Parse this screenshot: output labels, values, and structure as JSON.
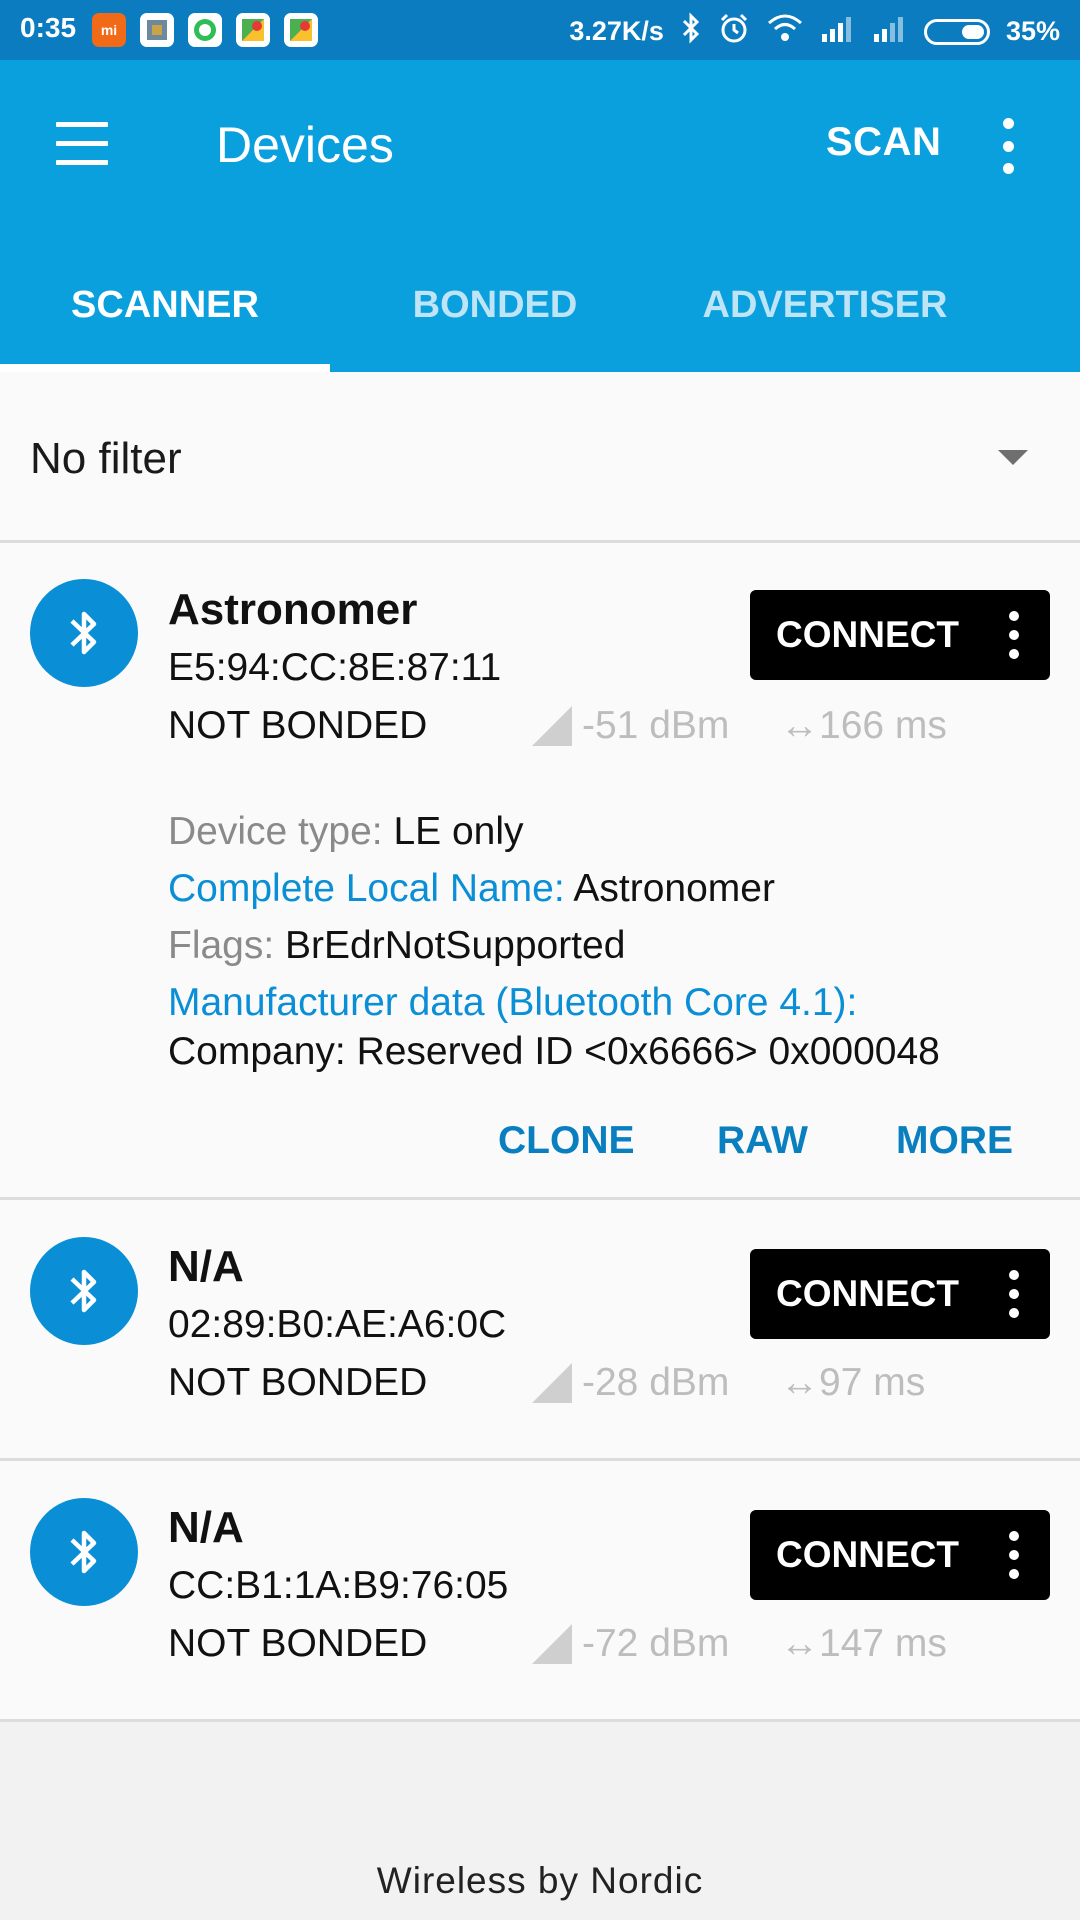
{
  "status_bar": {
    "time": "0:35",
    "notification_icons": [
      "mi-icon",
      "photo-app-icon",
      "whatsapp-icon",
      "maps-icon",
      "maps-icon"
    ],
    "net_speed": "3.27K/s",
    "battery": "35%"
  },
  "app_bar": {
    "title": "Devices",
    "scan_label": "SCAN",
    "tabs": [
      {
        "label": "SCANNER",
        "active": true
      },
      {
        "label": "BONDED",
        "active": false
      },
      {
        "label": "ADVERTISER",
        "active": false
      }
    ]
  },
  "filter": {
    "selected": "No filter"
  },
  "devices": [
    {
      "name": "Astronomer",
      "address": "E5:94:CC:8E:87:11",
      "bond": "NOT BONDED",
      "rssi": "-51 dBm",
      "interval": "↔166 ms",
      "connect": "CONNECT",
      "details": {
        "device_type_key": "Device type:",
        "device_type_val": "LE only",
        "local_name_key": "Complete Local Name:",
        "local_name_val": "Astronomer",
        "flags_key": "Flags:",
        "flags_val": "BrEdrNotSupported",
        "mfr_key": "Manufacturer data (Bluetooth Core 4.1):",
        "mfr_val": "Company: Reserved ID <0x6666> 0x000048"
      },
      "actions": [
        "CLONE",
        "RAW",
        "MORE"
      ]
    },
    {
      "name": "N/A",
      "address": "02:89:B0:AE:A6:0C",
      "bond": "NOT BONDED",
      "rssi": "-28 dBm",
      "interval": "↔97 ms",
      "connect": "CONNECT"
    },
    {
      "name": "N/A",
      "address": "CC:B1:1A:B9:76:05",
      "bond": "NOT BONDED",
      "rssi": "-72 dBm",
      "interval": "↔147 ms",
      "connect": "CONNECT"
    }
  ],
  "footer": "Wireless by Nordic",
  "colors": {
    "status_bar": "#0a7cbf",
    "app_bar": "#0aa0de",
    "accent": "#0a8fd6",
    "button": "#000000"
  }
}
